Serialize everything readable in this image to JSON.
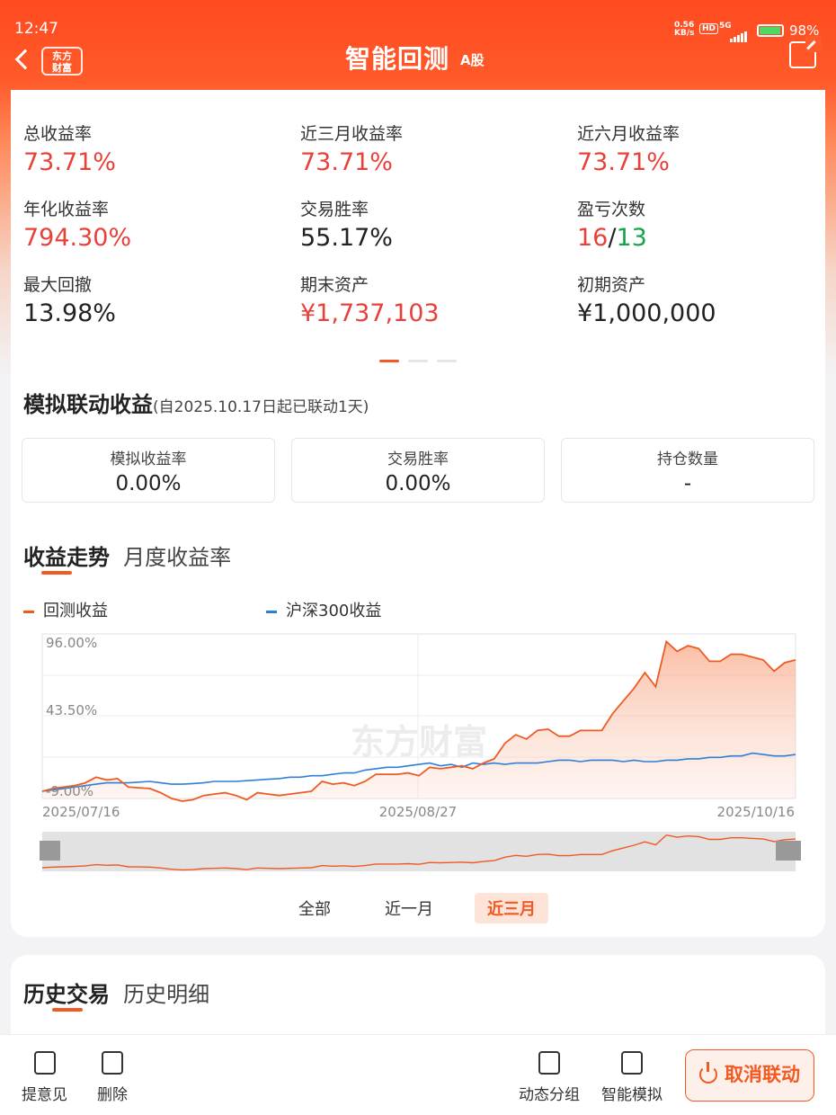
{
  "status_bar": {
    "time": "12:47",
    "net_speed": "0.56",
    "net_unit": "KB/s",
    "hd": "HD",
    "signal": "5G",
    "battery": "98%"
  },
  "titlebar": {
    "logo_line1": "东方",
    "logo_line2": "财富",
    "title": "智能回测",
    "market": "A股"
  },
  "metrics": [
    {
      "label": "总收益率",
      "value": "73.71%",
      "color": "red"
    },
    {
      "label": "近三月收益率",
      "value": "73.71%",
      "color": "red"
    },
    {
      "label": "近六月收益率",
      "value": "73.71%",
      "color": "red"
    },
    {
      "label": "年化收益率",
      "value": "794.30%",
      "color": "red"
    },
    {
      "label": "交易胜率",
      "value": "55.17%",
      "color": "dark"
    },
    {
      "label": "盈亏次数",
      "value_win": "16",
      "sep": "/",
      "value_loss": "13"
    },
    {
      "label": "最大回撤",
      "value": "13.98%",
      "color": "dark"
    },
    {
      "label": "期末资产",
      "value": "¥1,737,103",
      "color": "red"
    },
    {
      "label": "初期资产",
      "value": "¥1,000,000",
      "color": "dark"
    }
  ],
  "sim": {
    "title": "模拟联动收益",
    "subtitle": "(自2025.10.17日起已联动1天)",
    "boxes": [
      {
        "label": "模拟收益率",
        "value": "0.00%"
      },
      {
        "label": "交易胜率",
        "value": "0.00%"
      },
      {
        "label": "持仓数量",
        "value": "-"
      }
    ]
  },
  "tabs": {
    "trend": "收益走势",
    "monthly": "月度收益率"
  },
  "legend": {
    "backtest": "回测收益",
    "hs300": "沪深300收益"
  },
  "colors": {
    "accent": "#f25a22",
    "backtest": "#ee5a24",
    "hs300": "#2f7fd8",
    "profit": "#e8413a",
    "loss": "#16a34a"
  },
  "chart_data": {
    "type": "line",
    "watermark": "东方财富",
    "x_labels": [
      "2025/07/16",
      "2025/08/27",
      "2025/10/16"
    ],
    "y_labels": [
      "96.00%",
      "43.50%",
      "-9.00%"
    ],
    "ylim": [
      -9.0,
      96.0
    ],
    "series": [
      {
        "name": "回测收益",
        "values": [
          -9,
          -7,
          -6,
          -5,
          -3,
          1,
          -1,
          0,
          -6,
          -6.5,
          -7,
          -10,
          -14,
          -16,
          -15,
          -12,
          -11,
          -10,
          -12,
          -15,
          -10,
          -11,
          -12,
          -11,
          -10,
          -9,
          -2,
          -4,
          -3,
          -5,
          -2,
          3,
          3,
          3,
          4,
          2,
          8,
          7,
          8,
          9,
          7,
          11,
          14,
          25,
          31,
          28,
          34,
          35,
          30,
          30,
          34,
          34,
          34,
          46,
          55,
          64,
          75,
          65,
          97,
          90,
          94,
          92,
          83,
          83,
          88,
          88,
          86,
          84,
          76,
          82,
          84
        ]
      },
      {
        "name": "沪深300收益",
        "values": [
          -9,
          -8,
          -7,
          -6,
          -5,
          -4,
          -3,
          -3,
          -3,
          -2.5,
          -2,
          -3,
          -4,
          -4,
          -3.5,
          -3,
          -2,
          -2,
          -2,
          -1.5,
          -1,
          -0.5,
          0,
          1,
          1,
          2,
          2,
          3,
          4,
          4,
          6,
          7,
          8,
          8,
          9,
          10,
          11,
          9,
          10,
          8,
          11,
          10,
          11,
          10,
          11,
          11,
          11,
          12,
          13,
          13,
          12,
          13,
          13,
          13,
          12,
          13,
          12,
          12,
          13,
          13,
          14,
          14,
          15,
          15,
          16,
          16,
          18,
          17,
          16,
          16,
          17
        ]
      }
    ]
  },
  "range_tabs": {
    "all": "全部",
    "month": "近一月",
    "quarter": "近三月"
  },
  "history": {
    "trades": "历史交易",
    "details": "历史明细"
  },
  "bottom": {
    "feedback": "提意见",
    "delete": "删除",
    "group": "动态分组",
    "simulate": "智能模拟",
    "cancel": "取消联动"
  }
}
